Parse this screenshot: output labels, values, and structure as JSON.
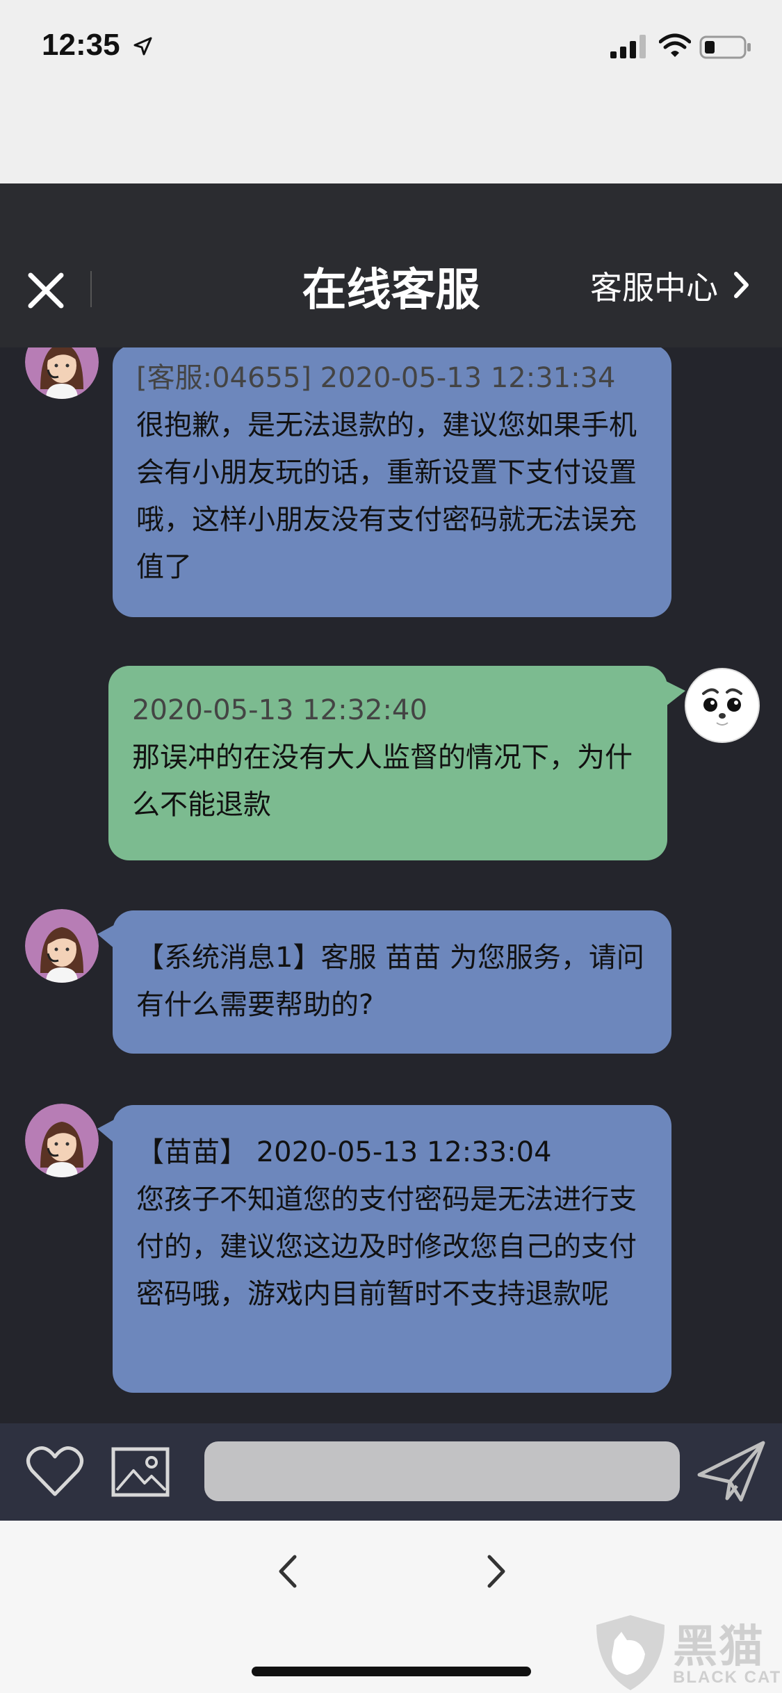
{
  "status_bar": {
    "time": "12:35"
  },
  "header": {
    "title": "在线客服",
    "right_link": "客服中心"
  },
  "messages": [
    {
      "sender": "agent",
      "meta": "[客服:04655] 2020-05-13 12:31:34",
      "text": "很抱歉，是无法退款的，建议您如果手机会有小朋友玩的话，重新设置下支付设置哦，这样小朋友没有支付密码就无法误充值了"
    },
    {
      "sender": "user",
      "meta": "2020-05-13 12:32:40",
      "text": "那误冲的在没有大人监督的情况下，为什么不能退款"
    },
    {
      "sender": "agent",
      "meta": "",
      "text": "【系统消息1】客服 苗苗 为您服务，请问有什么需要帮助的?"
    },
    {
      "sender": "agent",
      "meta": "【苗苗】 2020-05-13 12:33:04",
      "text": "您孩子不知道您的支付密码是无法进行支付的，建议您这边及时修改您自己的支付密码哦，游戏内目前暂时不支持退款呢"
    }
  ],
  "input": {
    "value": "",
    "placeholder": ""
  },
  "watermark": {
    "text": "黑猫",
    "sub": "BLACK CAT"
  },
  "colors": {
    "agent_bubble": "#6d87bc",
    "user_bubble": "#7cbb90",
    "header": "#2b2c30",
    "chat_bg": "#24252c"
  }
}
